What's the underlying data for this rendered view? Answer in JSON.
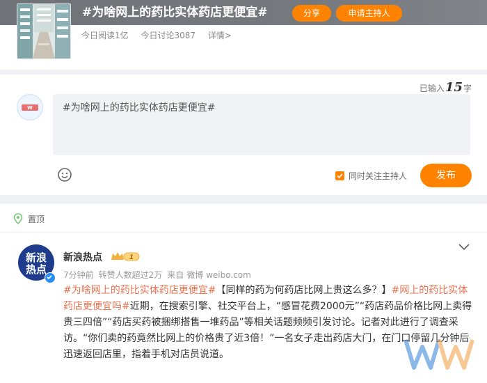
{
  "topic": {
    "title": "#为啥网上的药比实体药店更便宜#",
    "share_label": "分享",
    "host_label": "申请主持人",
    "stats": {
      "reads": "今日阅读1亿",
      "discussions": "今日讨论3087",
      "detail": "详情>"
    }
  },
  "composer": {
    "count_prefix": "已输入",
    "count": "15",
    "count_suffix": "字",
    "input_value": "#为啥网上的药比实体药店更便宜#",
    "follow_label": "同时关注主持人",
    "follow_checked": true,
    "publish_label": "发布"
  },
  "feed": {
    "pinned_label": "置顶",
    "post": {
      "avatar_text_line1": "新浪",
      "avatar_text_line2": "热点",
      "author": "新浪热点",
      "vip_level": "1",
      "time": "7分钟前",
      "reposts": "转赞人数超过2万",
      "source_prefix": "来自",
      "source": "微博 weibo.com",
      "tag1": "#为啥网上的药比实体药店更便宜#",
      "text1": "【同样的药为何药店比网上贵这么多？】",
      "tag2": "#网上的药比实体药店更便宜吗#",
      "text2": "近期，在搜索引擎、社交平台上，“感冒花费2000元”“药店药品价格比网上卖得贵三四倍”“药店买药被捆绑搭售一堆药品”等相关话题频频引发讨论。记者对此进行了调查采访。“你们卖的药竟然比网上的价格贵了近3倍！”一名女子走出药店大门，在门口停留几分钟后迅速返回店里，指着手机对店员说道。"
    }
  },
  "colors": {
    "accent": "#ff8200",
    "tag": "#eb7350",
    "verified": "#2a8ef3"
  }
}
